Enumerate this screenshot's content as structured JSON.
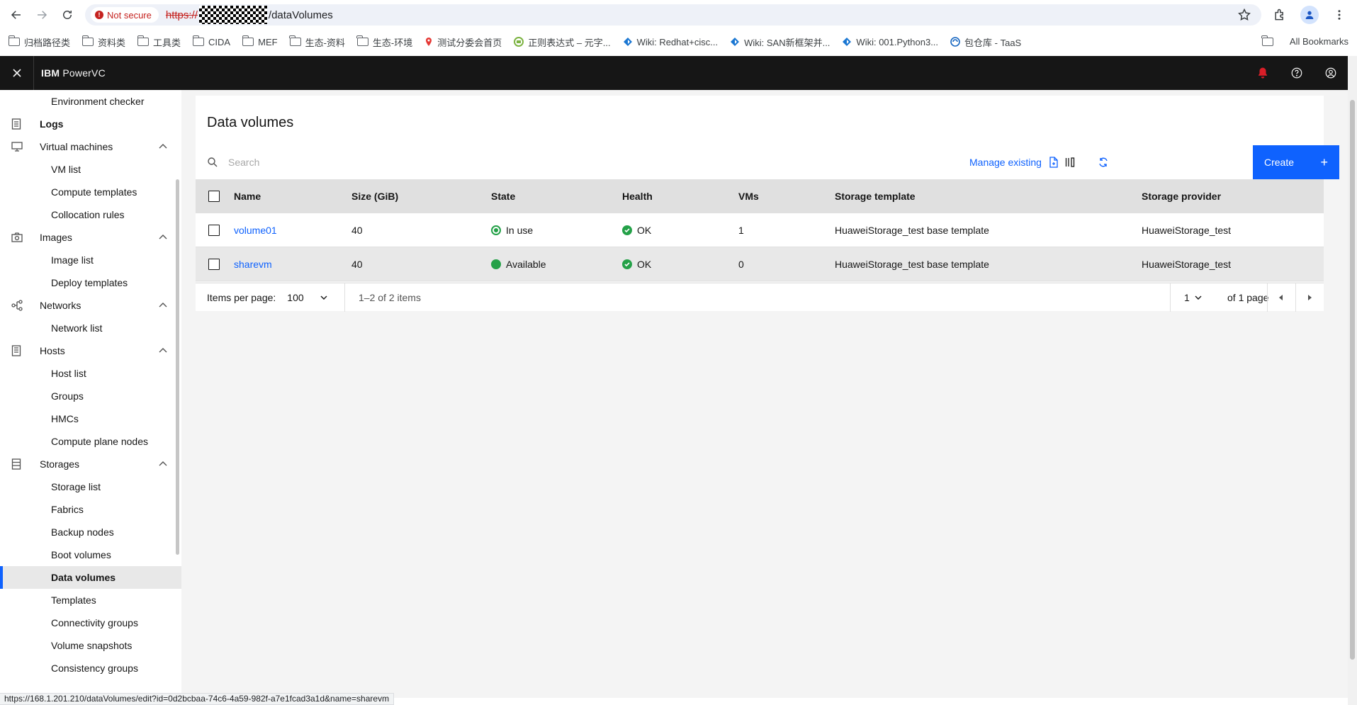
{
  "browser": {
    "security_label": "Not secure",
    "url_scheme": "https://",
    "url_path": "/dataVolumes",
    "status_url": "https://168.1.201.210/dataVolumes/edit?id=0d2bcbaa-74c6-4a59-982f-a7e1fcad3a1d&name=sharevm"
  },
  "bookmarks": {
    "items": [
      {
        "label": "归档路径类",
        "icon": "folder-icon"
      },
      {
        "label": "资料类",
        "icon": "folder-icon"
      },
      {
        "label": "工具类",
        "icon": "folder-icon"
      },
      {
        "label": "CIDA",
        "icon": "folder-icon"
      },
      {
        "label": "MEF",
        "icon": "folder-icon"
      },
      {
        "label": "生态-资料",
        "icon": "folder-icon"
      },
      {
        "label": "生态-环境",
        "icon": "folder-icon"
      },
      {
        "label": "测试分委会首页",
        "icon": "favicon-red",
        "color": "#e53935"
      },
      {
        "label": "正则表达式 – 元字...",
        "icon": "favicon-green",
        "color": "#7cb342"
      },
      {
        "label": "Wiki: Redhat+cisc...",
        "icon": "favicon-wiki",
        "color": "#1976d2"
      },
      {
        "label": "Wiki: SAN新框架并...",
        "icon": "favicon-wiki",
        "color": "#1976d2"
      },
      {
        "label": "Wiki: 001.Python3...",
        "icon": "favicon-wiki",
        "color": "#1976d2"
      },
      {
        "label": "包仓库 - TaaS",
        "icon": "favicon-taas",
        "color": "#1565c0"
      }
    ],
    "all_label": "All Bookmarks"
  },
  "app": {
    "brand": "IBM",
    "product": "PowerVC",
    "notification_color": "#da1e28"
  },
  "sidebar": {
    "items": [
      {
        "label": "Environment checker",
        "type": "sub"
      },
      {
        "label": "Logs",
        "type": "group",
        "icon": "logs-icon",
        "bold": true,
        "expandable": false
      },
      {
        "label": "Virtual machines",
        "type": "group",
        "icon": "monitor-icon",
        "expandable": true
      },
      {
        "label": "VM list",
        "type": "sub"
      },
      {
        "label": "Compute templates",
        "type": "sub"
      },
      {
        "label": "Collocation rules",
        "type": "sub"
      },
      {
        "label": "Images",
        "type": "group",
        "icon": "camera-icon",
        "expandable": true
      },
      {
        "label": "Image list",
        "type": "sub"
      },
      {
        "label": "Deploy templates",
        "type": "sub"
      },
      {
        "label": "Networks",
        "type": "group",
        "icon": "network-icon",
        "expandable": true
      },
      {
        "label": "Network list",
        "type": "sub"
      },
      {
        "label": "Hosts",
        "type": "group",
        "icon": "host-icon",
        "expandable": true
      },
      {
        "label": "Host list",
        "type": "sub"
      },
      {
        "label": "Groups",
        "type": "sub"
      },
      {
        "label": "HMCs",
        "type": "sub"
      },
      {
        "label": "Compute plane nodes",
        "type": "sub"
      },
      {
        "label": "Storages",
        "type": "group",
        "icon": "storage-icon",
        "expandable": true
      },
      {
        "label": "Storage list",
        "type": "sub"
      },
      {
        "label": "Fabrics",
        "type": "sub"
      },
      {
        "label": "Backup nodes",
        "type": "sub"
      },
      {
        "label": "Boot volumes",
        "type": "sub"
      },
      {
        "label": "Data volumes",
        "type": "sub",
        "active": true
      },
      {
        "label": "Templates",
        "type": "sub"
      },
      {
        "label": "Connectivity groups",
        "type": "sub"
      },
      {
        "label": "Volume snapshots",
        "type": "sub"
      },
      {
        "label": "Consistency groups",
        "type": "sub"
      }
    ]
  },
  "main": {
    "title": "Data volumes",
    "search_placeholder": "Search",
    "manage_label": "Manage existing",
    "create_label": "Create",
    "columns": [
      "Name",
      "Size (GiB)",
      "State",
      "Health",
      "VMs",
      "Storage template",
      "Storage provider"
    ],
    "rows": [
      {
        "name": "volume01",
        "size": "40",
        "state": "In use",
        "state_kind": "in-use",
        "health": "OK",
        "vms": "1",
        "template": "HuaweiStorage_test base template",
        "provider": "HuaweiStorage_test"
      },
      {
        "name": "sharevm",
        "size": "40",
        "state": "Available",
        "state_kind": "available",
        "health": "OK",
        "vms": "0",
        "template": "HuaweiStorage_test base template",
        "provider": "HuaweiStorage_test"
      }
    ],
    "pagination": {
      "items_per_page_label": "Items per page:",
      "items_per_page": "100",
      "range": "1–2 of 2 items",
      "page": "1",
      "of_pages": "of 1 page"
    }
  }
}
